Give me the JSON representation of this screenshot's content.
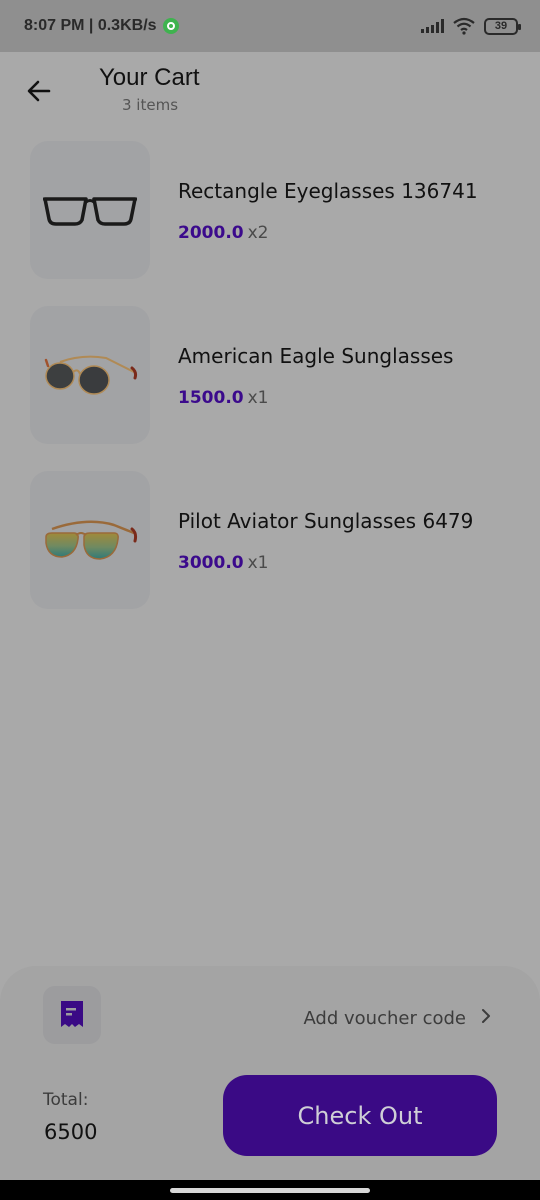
{
  "status_bar": {
    "time": "8:07 PM | 0.3KB/s",
    "battery": "39",
    "icons": [
      "whatsapp-icon",
      "signal-icon",
      "wifi-icon",
      "battery-icon"
    ]
  },
  "header": {
    "back_icon": "arrow-left-icon",
    "title": "Your Cart",
    "subtitle": "3 items"
  },
  "items": [
    {
      "name": "Rectangle Eyeglasses 136741",
      "price": "2000.0",
      "qty": "x2",
      "image": "rectangle-eyeglasses"
    },
    {
      "name": "American Eagle Sunglasses",
      "price": "1500.0",
      "qty": "x1",
      "image": "round-sunglasses"
    },
    {
      "name": "Pilot Aviator Sunglasses 6479",
      "price": "3000.0",
      "qty": "x1",
      "image": "aviator-sunglasses"
    }
  ],
  "voucher": {
    "icon": "receipt-icon",
    "label": "Add voucher code",
    "chevron": "chevron-right-icon"
  },
  "total": {
    "label": "Total:",
    "value": "6500"
  },
  "checkout": {
    "label": "Check Out"
  },
  "colors": {
    "accent": "#3a0a85",
    "price": "#3b0a8c",
    "background": "#a9a9a9"
  }
}
